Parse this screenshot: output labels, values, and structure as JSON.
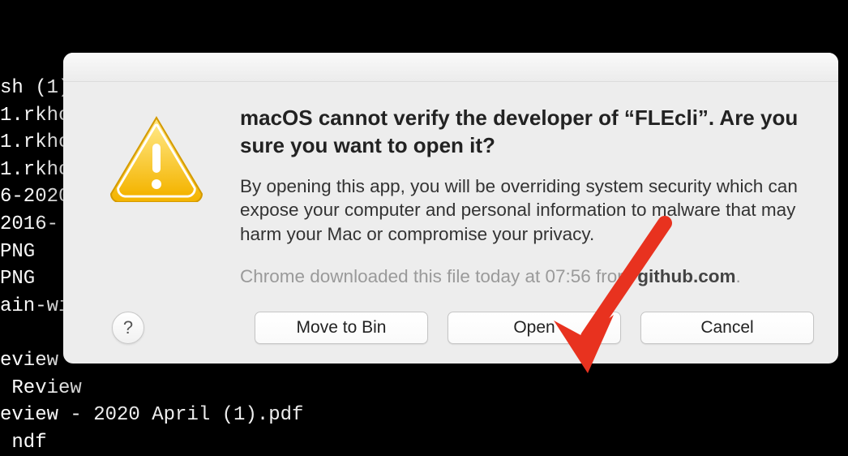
{
  "terminal": {
    "lines": "sh (1)\n1.rkhc\n1.rkhc\n1.rkhc\n6-2020\n2016-\nPNG\nPNG\nain-wi\n\neview\n Review\neview - 2020 April (1).pdf\n ndf"
  },
  "dialog": {
    "title": "macOS cannot verify the developer of “FLEcli”. Are you sure you want to open it?",
    "message": "By opening this app, you will be overriding system security which can expose your computer and personal information to malware that may harm your Mac or compromise your privacy.",
    "source_prefix": "Chrome downloaded this file today at 07:56 from ",
    "source_domain": "github.com",
    "source_suffix": ".",
    "buttons": {
      "move_to_bin": "Move to Bin",
      "open": "Open",
      "cancel": "Cancel"
    },
    "help_label": "?"
  }
}
